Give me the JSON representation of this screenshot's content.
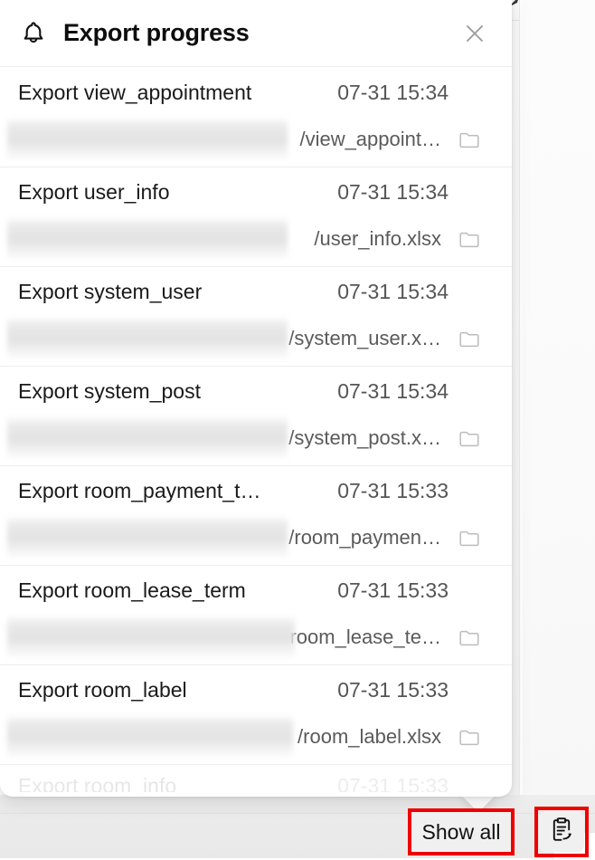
{
  "panel": {
    "title": "Export progress",
    "bell_icon": "bell-icon",
    "close_icon": "close-icon"
  },
  "colors": {
    "highlight": "#ee0000",
    "panel_background": "#ffffff",
    "title_text": "#0d0d0d",
    "secondary_text": "#555555",
    "divider": "#ededed",
    "button_background": "#f0f0f0"
  },
  "list": {
    "rows": [
      {
        "task": "Export view_appointment",
        "time": "07-31 15:34",
        "path": "/view_appoint…",
        "path_redacted": true,
        "folder_icon": "folder-icon"
      },
      {
        "task": "Export user_info",
        "time": "07-31 15:34",
        "path": "/user_info.xlsx",
        "path_redacted": true,
        "folder_icon": "folder-icon"
      },
      {
        "task": "Export system_user",
        "time": "07-31 15:34",
        "path": "/system_user.x…",
        "path_redacted": true,
        "folder_icon": "folder-icon"
      },
      {
        "task": "Export system_post",
        "time": "07-31 15:34",
        "path": "/system_post.x…",
        "path_redacted": true,
        "folder_icon": "folder-icon"
      },
      {
        "task": "Export room_payment_t…",
        "time": "07-31 15:33",
        "path": "/room_paymen…",
        "path_redacted": true,
        "folder_icon": "folder-icon"
      },
      {
        "task": "Export room_lease_term",
        "time": "07-31 15:33",
        "path": "/room_lease_te…",
        "path_redacted": true,
        "folder_icon": "folder-icon"
      },
      {
        "task": "Export room_label",
        "time": "07-31 15:33",
        "path": "/room_label.xlsx",
        "path_redacted": true,
        "folder_icon": "folder-icon"
      }
    ],
    "partial_row": {
      "task": "Export room_info",
      "time": "07-31 15:33"
    }
  },
  "footer": {
    "show_all_label": "Show all"
  },
  "toolbar": {
    "export_button_icon": "clipboard-export-icon"
  }
}
